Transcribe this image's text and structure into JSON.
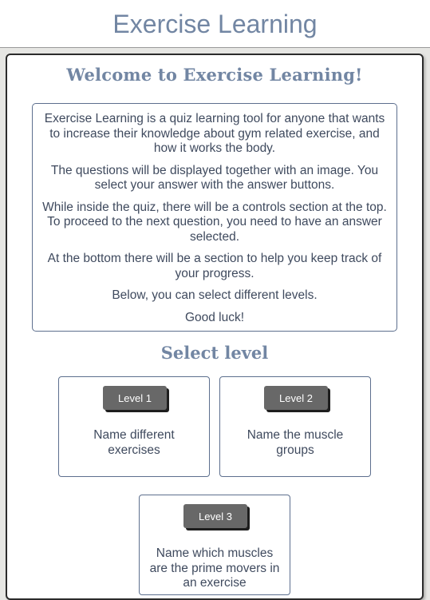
{
  "header": {
    "title": "Exercise Learning"
  },
  "welcome": {
    "heading": "Welcome to Exercise Learning!",
    "paragraphs": [
      "Exercise Learning is a quiz learning tool for anyone that wants to increase their knowledge about gym related exercise, and how it works the body.",
      "The questions will be displayed together with an image. You select your answer with the answer buttons.",
      "While inside the quiz, there will be a controls section at the top. To proceed to the next question, you need to have an answer selected.",
      "At the bottom there will be a section to help you keep track of your progress.",
      "Below, you can select different levels.",
      "Good luck!"
    ]
  },
  "levels": {
    "heading": "Select level",
    "items": [
      {
        "button": "Level 1",
        "description": "Name different exercises"
      },
      {
        "button": "Level 2",
        "description": "Name the muscle groups"
      },
      {
        "button": "Level 3",
        "description": "Name which muscles are the prime movers in an exercise"
      }
    ]
  },
  "colors": {
    "title": "#7286a3",
    "text": "#3f4a5e",
    "border": "#5d6f8e",
    "button": "#686868",
    "background": "#e6e6e3"
  }
}
